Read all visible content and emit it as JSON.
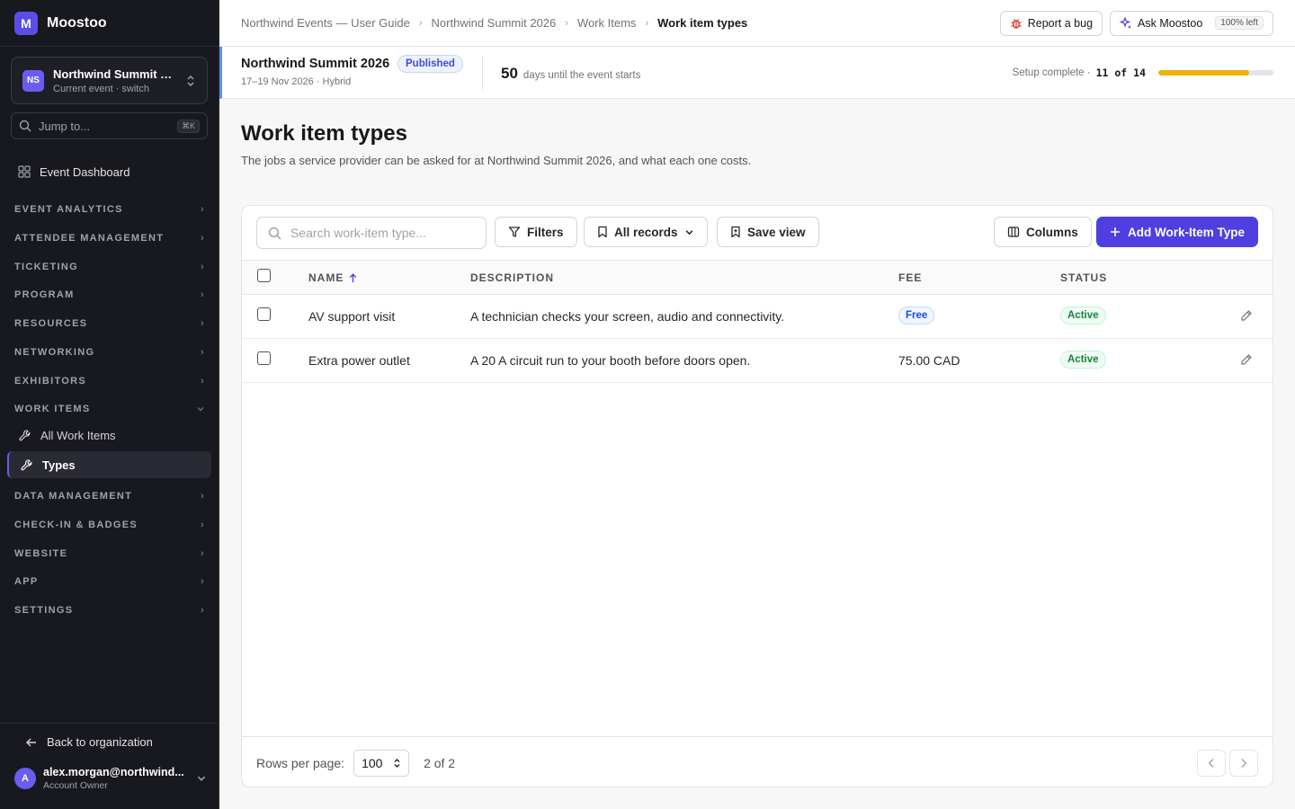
{
  "brand": {
    "logo_letter": "M",
    "name": "Moostoo"
  },
  "event_switcher": {
    "initials": "NS",
    "name": "Northwind Summit 2...",
    "sub": "Current event · switch"
  },
  "jump": {
    "placeholder": "Jump to...",
    "shortcut": "⌘K"
  },
  "sidebar": {
    "dashboard": "Event Dashboard",
    "groups": [
      "EVENT ANALYTICS",
      "ATTENDEE MANAGEMENT",
      "TICKETING",
      "PROGRAM",
      "RESOURCES",
      "NETWORKING",
      "EXHIBITORS",
      "WORK ITEMS",
      "DATA MANAGEMENT",
      "CHECK-IN & BADGES",
      "WEBSITE",
      "APP",
      "SETTINGS"
    ],
    "work_items_children": [
      "All Work Items",
      "Types"
    ],
    "back": "Back to organization",
    "user_initial": "A",
    "user_email": "alex.morgan@northwind...",
    "user_role": "Account Owner"
  },
  "breadcrumbs": [
    "Northwind Events — User Guide",
    "Northwind Summit 2026",
    "Work Items",
    "Work item types"
  ],
  "top_actions": {
    "bug": "Report a bug",
    "ask": "Ask Moostoo",
    "ask_badge": "100% left"
  },
  "event_strip": {
    "name": "Northwind Summit 2026",
    "status": "Published",
    "dates": "17–19 Nov 2026 · Hybrid",
    "days_num": "50",
    "days_text": "days until the event starts",
    "setup_label": "Setup complete ·",
    "setup_count": "11 of 14",
    "setup_progress": 0.786
  },
  "page": {
    "title": "Work item types",
    "description": "The jobs a service provider can be asked for at Northwind Summit 2026, and what each one costs."
  },
  "toolbar": {
    "search_placeholder": "Search work-item type...",
    "filters": "Filters",
    "records": "All records",
    "save_view": "Save view",
    "columns": "Columns",
    "add": "Add Work-Item Type"
  },
  "table": {
    "headers": {
      "name": "NAME",
      "description": "DESCRIPTION",
      "fee": "FEE",
      "status": "STATUS"
    },
    "rows": [
      {
        "name": "AV support visit",
        "description": "A technician checks your screen, audio and connectivity.",
        "fee": "Free",
        "status": "Active"
      },
      {
        "name": "Extra power outlet",
        "description": "A 20 A circuit run to your booth before doors open.",
        "fee": "75.00 CAD",
        "status": "Active"
      }
    ]
  },
  "footer": {
    "rows_label": "Rows per page:",
    "rows_value": "100",
    "count": "2 of 2"
  },
  "colors": {
    "accent": "#4f3fe0",
    "progress": "#eab308",
    "sidebar_bg": "#18181f"
  }
}
